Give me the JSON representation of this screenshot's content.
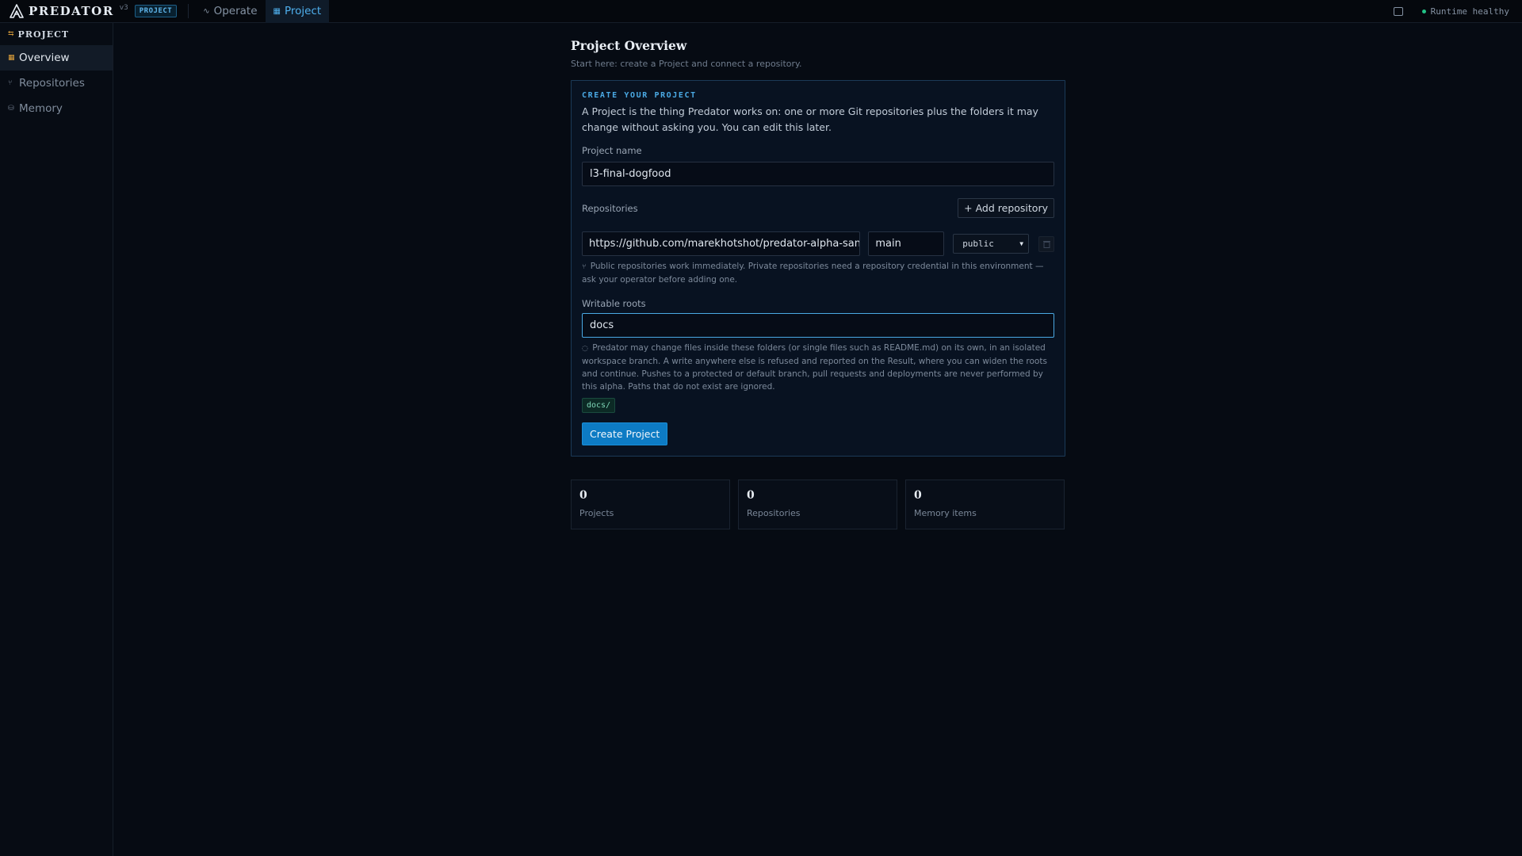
{
  "topbar": {
    "brand_name": "PREDATOR",
    "version": "v3",
    "badge": "PROJECT",
    "tabs": [
      {
        "label": "Operate",
        "icon": "activity-icon"
      },
      {
        "label": "Project",
        "icon": "grid-icon"
      }
    ],
    "status": "Runtime healthy",
    "status_color": "#22c286"
  },
  "sidebar": {
    "header": "PROJECT",
    "items": [
      {
        "label": "Overview",
        "icon": "grid-icon"
      },
      {
        "label": "Repositories",
        "icon": "git-branch-icon"
      },
      {
        "label": "Memory",
        "icon": "database-icon"
      }
    ]
  },
  "main": {
    "title": "Project Overview",
    "subtitle": "Start here: create a Project and connect a repository."
  },
  "form": {
    "card_label": "CREATE YOUR PROJECT",
    "description": "A Project is the thing Predator works on: one or more Git repositories plus the folders it may change without asking you. You can edit this later.",
    "project_name_label": "Project name",
    "project_name_value": "l3-final-dogfood",
    "repositories_label": "Repositories",
    "add_repository": "+ Add repository",
    "repo": {
      "url": "https://github.com/marekhotshot/predator-alpha-sandbox",
      "branch": "main",
      "visibility": "public"
    },
    "repo_hint": "Public repositories work immediately. Private repositories need a repository credential in this environment — ask your operator before adding one.",
    "writable_roots_label": "Writable roots",
    "writable_roots_value": "docs",
    "roots_hint": "Predator may change files inside these folders (or single files such as README.md) on its own, in an isolated workspace branch. A write anywhere else is refused and reported on the Result, where you can widen the roots and continue. Pushes to a protected or default branch, pull requests and deployments are never performed by this alpha. Paths that do not exist are ignored.",
    "root_chip": "docs/",
    "submit": "Create Project"
  },
  "stats": [
    {
      "value": "0",
      "label": "Projects"
    },
    {
      "value": "0",
      "label": "Repositories"
    },
    {
      "value": "0",
      "label": "Memory items"
    }
  ]
}
